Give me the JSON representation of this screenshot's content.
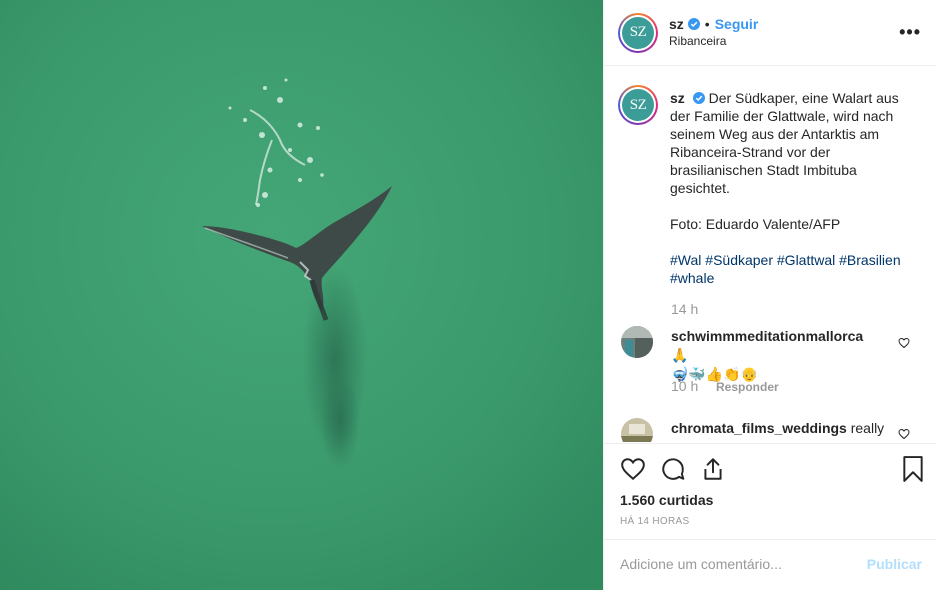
{
  "post": {
    "username": "sz",
    "avatar_text": "SZ",
    "follow_label": "Seguir",
    "location": "Ribanceira",
    "more_label": "•••"
  },
  "caption": {
    "username": "sz",
    "text": "Der Südkaper, eine Walart aus der Familie der Glattwale, wird nach seinem Weg aus der Antarktis am Ribanceira-Strand vor der brasilianischen Stadt Imbituba gesichtet.",
    "credit": "Foto: Eduardo Valente/AFP",
    "hashtags": [
      "#Wal",
      "#Südkaper",
      "#Glattwal",
      "#Brasilien",
      "#whale"
    ],
    "time": "14 h"
  },
  "comments": [
    {
      "username": "schwimmmeditationmallorca",
      "text_line1": "🙏",
      "text_line2": "🤿🐳👍👏👴",
      "time": "10 h",
      "reply_label": "Responder"
    },
    {
      "username": "chromata_films_weddings",
      "text": "really"
    }
  ],
  "footer": {
    "likes": "1.560 curtidas",
    "ago": "HÁ 14 HORAS",
    "comment_placeholder": "Adicione um comentário...",
    "publish_label": "Publicar"
  },
  "colors": {
    "accent": "#3897f0",
    "hashtag": "#003569",
    "water": "#3b9a6c",
    "avatar": "#3c9c97"
  },
  "icons": {
    "verified": "verified-badge-icon",
    "like": "heart-icon",
    "comment": "comment-bubble-icon",
    "share": "share-icon",
    "save": "bookmark-icon"
  }
}
